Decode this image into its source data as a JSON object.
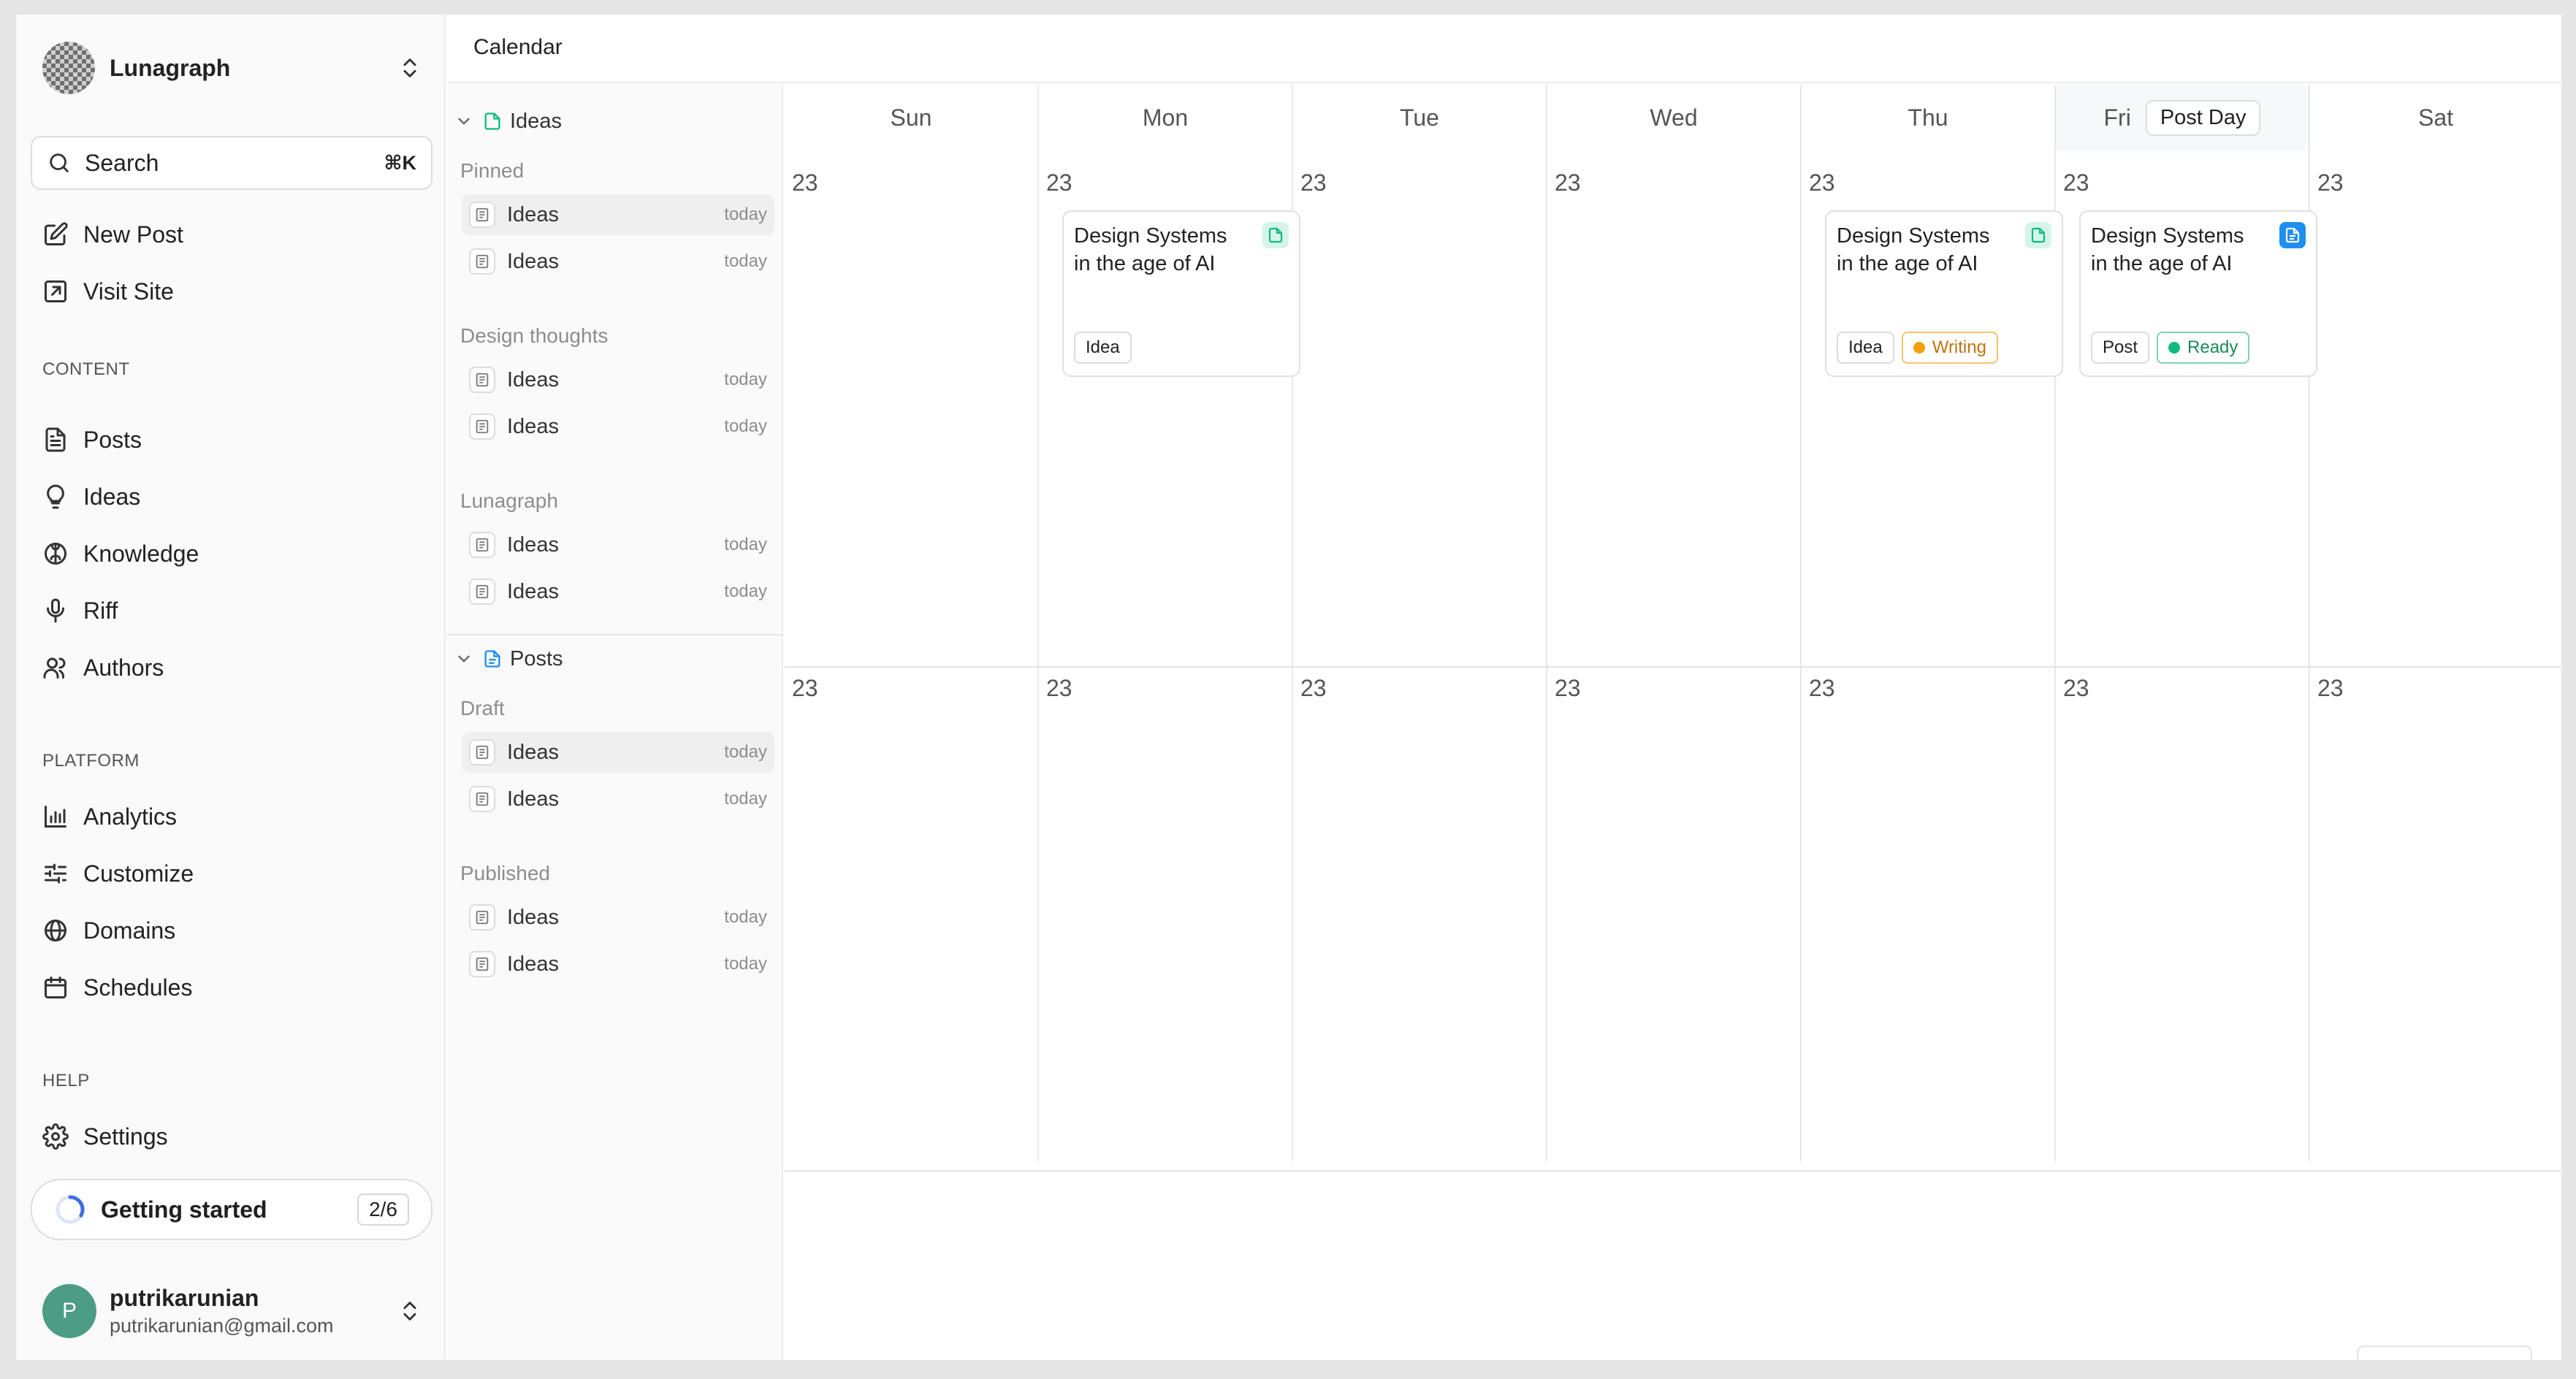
{
  "workspace": {
    "name": "Lunagraph"
  },
  "search": {
    "label": "Search",
    "shortcut": "⌘K"
  },
  "actions": [
    {
      "label": "New Post",
      "icon": "edit-icon"
    },
    {
      "label": "Visit Site",
      "icon": "external-link-icon"
    }
  ],
  "sections": {
    "content": {
      "label": "CONTENT",
      "items": [
        {
          "label": "Posts",
          "icon": "file-icon"
        },
        {
          "label": "Ideas",
          "icon": "lightbulb-icon"
        },
        {
          "label": "Knowledge",
          "icon": "brain-icon"
        },
        {
          "label": "Riff",
          "icon": "mic-icon"
        },
        {
          "label": "Authors",
          "icon": "users-icon"
        }
      ]
    },
    "platform": {
      "label": "PLATFORM",
      "items": [
        {
          "label": "Analytics",
          "icon": "bar-chart-icon"
        },
        {
          "label": "Customize",
          "icon": "sliders-icon"
        },
        {
          "label": "Domains",
          "icon": "globe-icon"
        },
        {
          "label": "Schedules",
          "icon": "calendar-icon"
        }
      ]
    },
    "help": {
      "label": "HELP",
      "items": [
        {
          "label": "Settings",
          "icon": "gear-icon"
        }
      ]
    }
  },
  "getting_started": {
    "label": "Getting started",
    "count": "2/6",
    "progress": 0.33
  },
  "user": {
    "name": "putrikarunian",
    "email": "putrikarunian@gmail.com",
    "initial": "P"
  },
  "header": {
    "title": "Calendar"
  },
  "panel": {
    "ideas": {
      "label": "Ideas",
      "groups": [
        {
          "label": "Pinned",
          "items": [
            {
              "title": "Ideas",
              "date": "today"
            },
            {
              "title": "Ideas",
              "date": "today"
            }
          ]
        },
        {
          "label": "Design thoughts",
          "items": [
            {
              "title": "Ideas",
              "date": "today"
            },
            {
              "title": "Ideas",
              "date": "today"
            }
          ]
        },
        {
          "label": "Lunagraph",
          "items": [
            {
              "title": "Ideas",
              "date": "today"
            },
            {
              "title": "Ideas",
              "date": "today"
            }
          ]
        }
      ]
    },
    "posts": {
      "label": "Posts",
      "groups": [
        {
          "label": "Draft",
          "items": [
            {
              "title": "Ideas",
              "date": "today"
            },
            {
              "title": "Ideas",
              "date": "today"
            }
          ]
        },
        {
          "label": "Published",
          "items": [
            {
              "title": "Ideas",
              "date": "today"
            },
            {
              "title": "Ideas",
              "date": "today"
            }
          ]
        }
      ]
    }
  },
  "calendar": {
    "days": [
      "Sun",
      "Mon",
      "Tue",
      "Wed",
      "Thu",
      "Fri",
      "Sat"
    ],
    "post_day_label": "Post Day",
    "week1": [
      "23",
      "23",
      "23",
      "23",
      "23",
      "23",
      "23"
    ],
    "week2": [
      "23",
      "23",
      "23",
      "23",
      "23",
      "23",
      "23"
    ],
    "cards": [
      {
        "day": "Mon",
        "title": "Design Systems in the age of AI",
        "icon": "idea-doc-icon",
        "tags": [
          "Idea"
        ]
      },
      {
        "day": "Thu",
        "title": "Design Systems in the age of AI",
        "icon": "idea-doc-icon",
        "tags": [
          "Idea",
          "Writing"
        ]
      },
      {
        "day": "Fri",
        "title": "Design Systems in the age of AI",
        "icon": "post-doc-icon",
        "tags": [
          "Post",
          "Ready"
        ]
      }
    ]
  },
  "colors": {
    "accent_green": "#10b981",
    "accent_blue": "#1f8ef1",
    "writing": "#f59e0b",
    "ready": "#10b981",
    "avatar": "#4d9c86"
  }
}
